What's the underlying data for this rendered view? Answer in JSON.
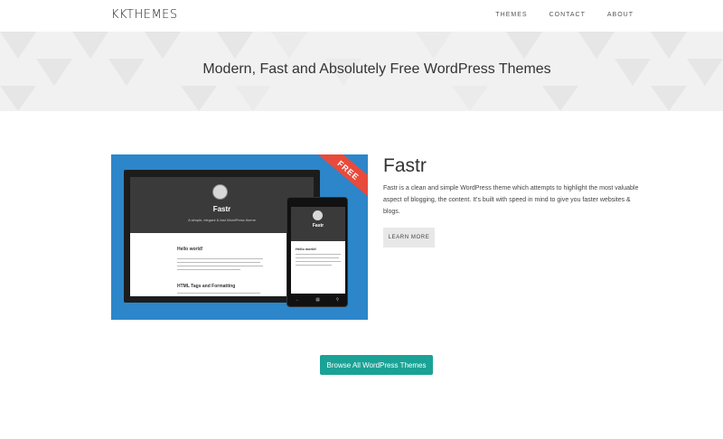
{
  "header": {
    "logo": "KKTHEMES",
    "nav": [
      {
        "label": "THEMES"
      },
      {
        "label": "CONTACT"
      },
      {
        "label": "ABOUT"
      }
    ]
  },
  "hero": {
    "title": "Modern, Fast and Absolutely Free WordPress Themes"
  },
  "theme": {
    "ribbon": "FREE",
    "preview": {
      "site_title": "Fastr",
      "site_tagline": "A simple, elegant & fast WordPress theme",
      "post1_title": "Hello world!",
      "post2_title": "HTML Tags and Formatting",
      "phone_post_title": "Hello world!"
    },
    "name": "Fastr",
    "description": "Fastr is a clean and simple WordPress theme which attempts to highlight the most valuable aspect of blogging, the content. It's built with speed in mind to give you faster websites & blogs.",
    "learn_more": "LEARN MORE"
  },
  "browse_all": "Browse All WordPress Themes",
  "colors": {
    "accent": "#1aa296",
    "preview_bg": "#2c86c9",
    "ribbon": "#e84a3c",
    "hero_bg": "#f1f1f1"
  }
}
